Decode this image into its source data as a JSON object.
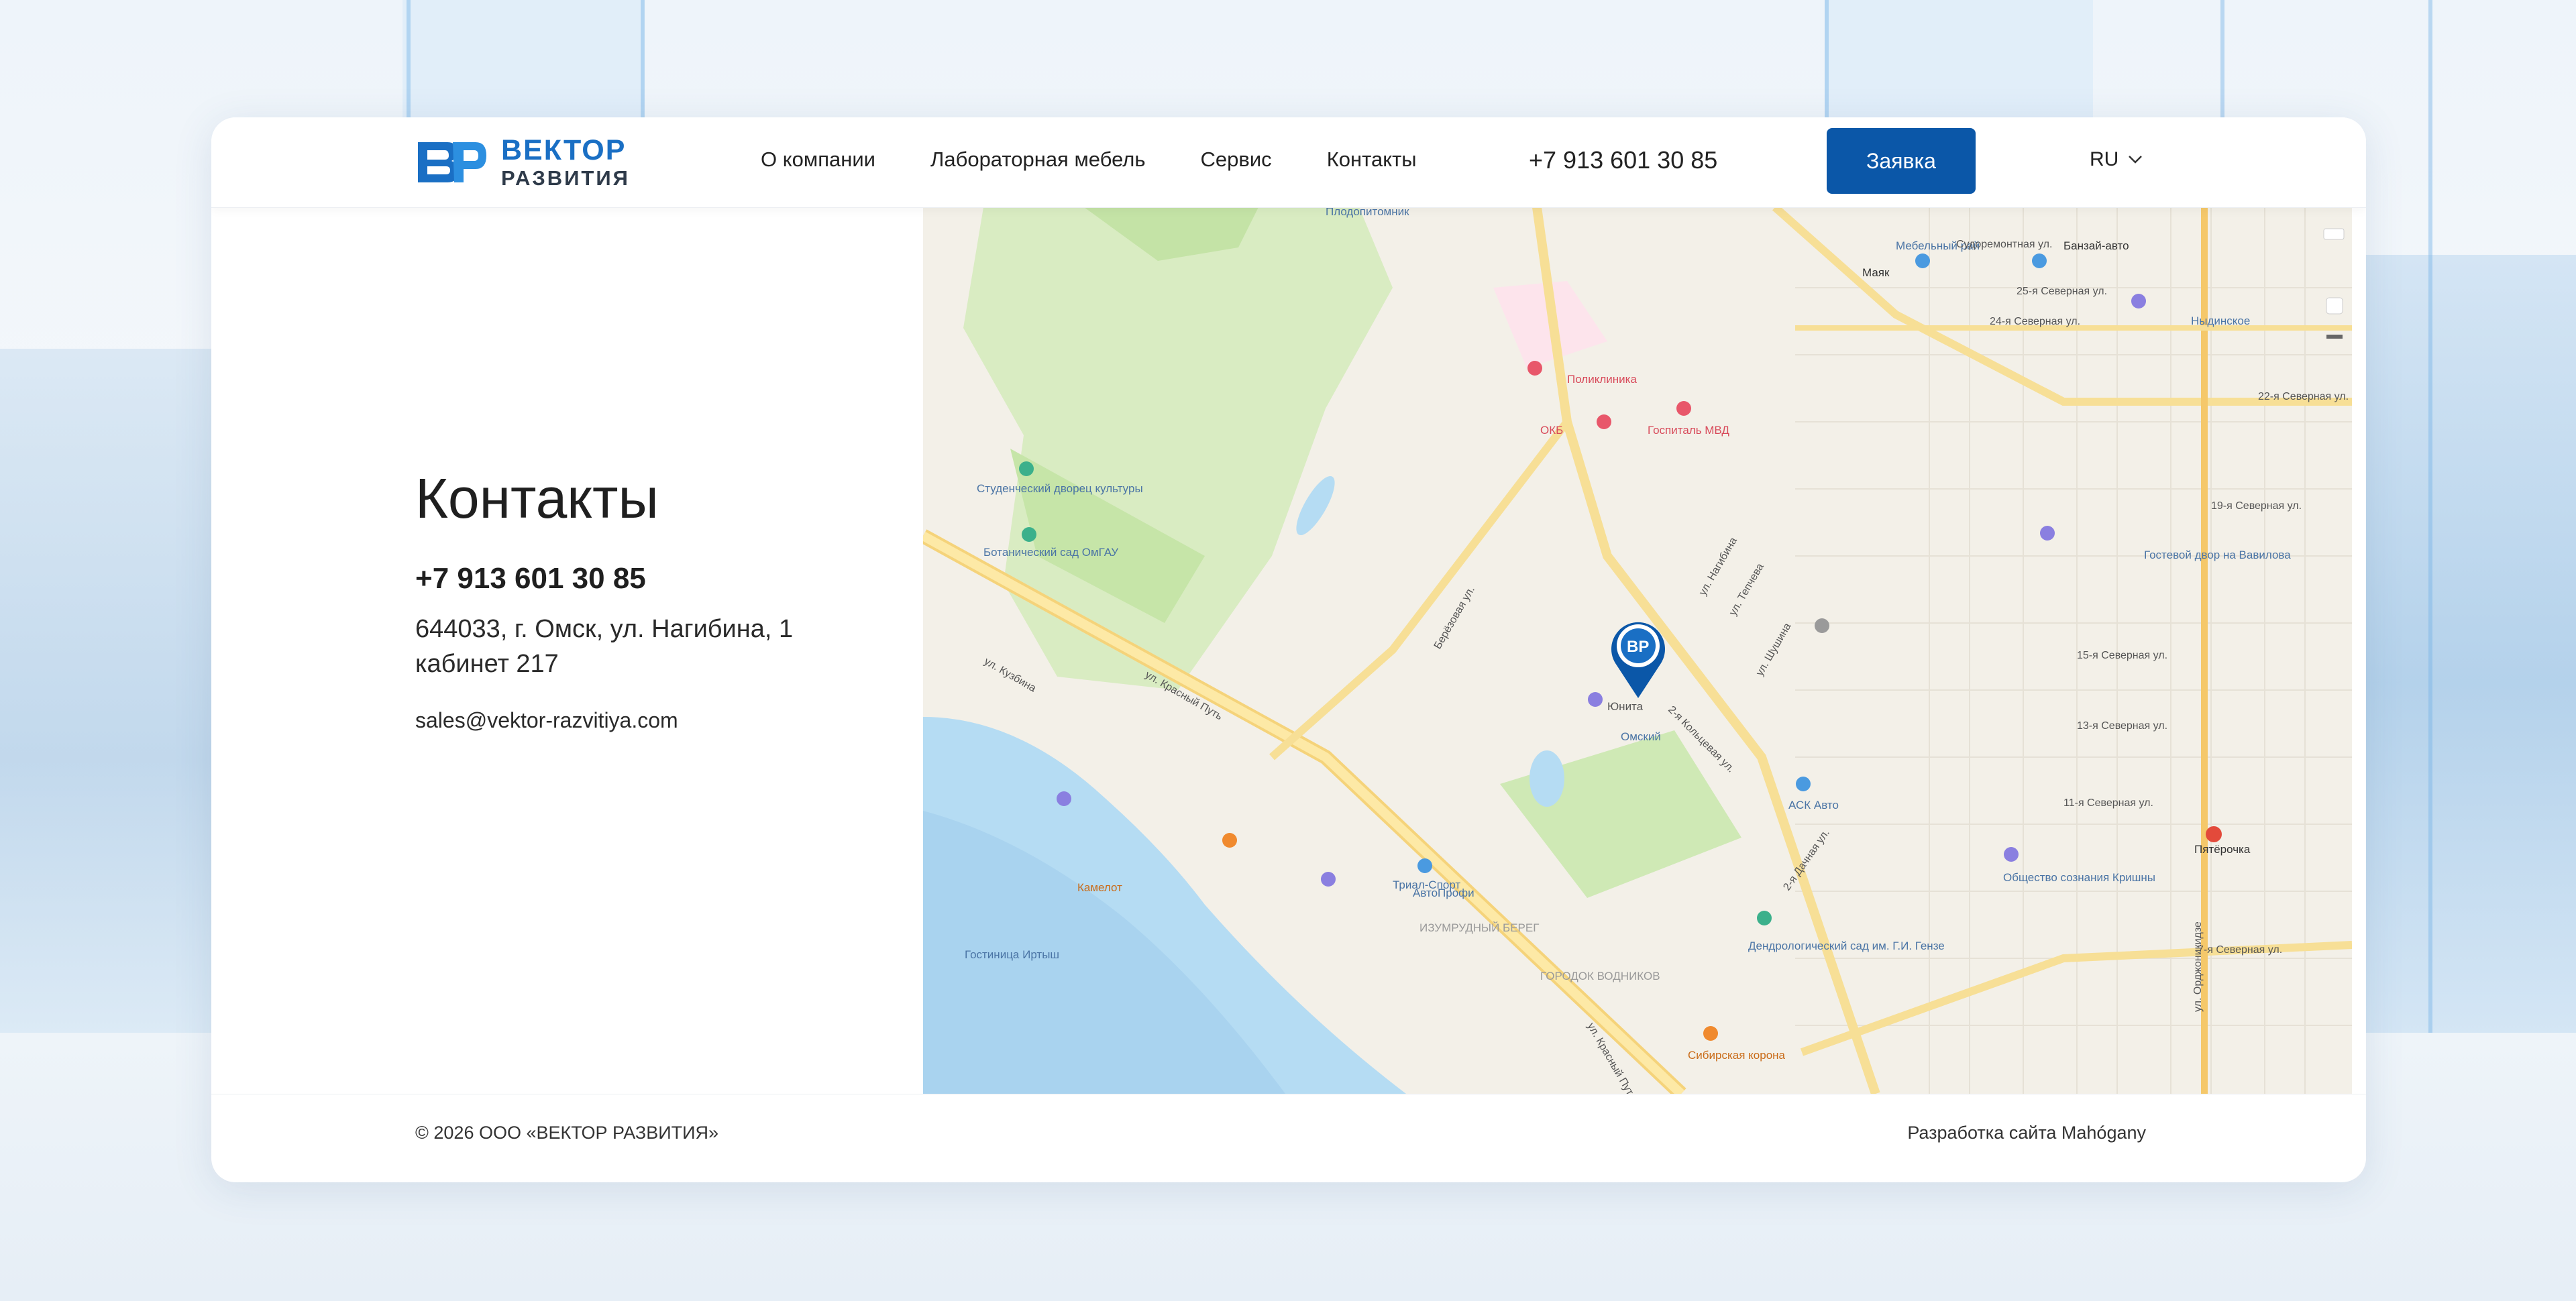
{
  "brand": {
    "name_line1": "ВЕКТОР",
    "name_line2": "РАЗВИТИЯ",
    "color": "#1a6fc4"
  },
  "nav": {
    "items": [
      {
        "label": "О компании"
      },
      {
        "label": "Лабораторная мебель"
      },
      {
        "label": "Сервис"
      },
      {
        "label": "Контакты"
      }
    ],
    "phone": "+7 913 601 30 85",
    "cta": "Заявка",
    "lang": "RU"
  },
  "contacts": {
    "title": "Контакты",
    "phone": "+7 913 601 30 85",
    "address_line1": "644033, г. Омск, ул. Нагибина, 1",
    "address_line2": "кабинет 217",
    "email": "sales@vektor-razvitiya.com"
  },
  "map": {
    "labels": {
      "plodopitomnik": "Плодопитомник",
      "poliklinika": "Поликлиника",
      "okb": "ОКБ",
      "gospital": "Госпиталь МВД",
      "studdvorets": "Студенческий дворец культуры",
      "botsad": "Ботанический сад ОмГАУ",
      "omskiy": "Омский",
      "yunita": "Юнита",
      "askavto": "АСК Авто",
      "gostinica": "Гостиница Иртыш",
      "kamelot": "Камелот",
      "avtoprofi": "АвтоПрофи",
      "trialsport": "Триал-Спорт",
      "dendrosad": "Дендрологический сад им. Г.И. Гензе",
      "izumrud": "ИЗУМРУДНЫЙ БЕРЕГ",
      "gorodok": "ГОРОДОК ВОДНИКОВ",
      "sibkorona": "Сибирская корона",
      "mayak": "Маяк",
      "mebelray": "Мебельный рай",
      "banzay": "Банзай-авто",
      "nydinskoe": "Ныдинское",
      "gostdvor": "Гостевой двор на Вавилова",
      "obshchestvo": "Общество сознания Кришны",
      "pyaterochka": "Пятёрочка",
      "krasny_put": "ул. Красный Путь",
      "krasny_put2": "ул. Красный Путь",
      "berezovaya": "Берёзовая ул.",
      "kuzbina": "ул. Кузбина",
      "koltsevaya": "2-я Кольцевая ул.",
      "nagibina": "ул. Нагибина",
      "tepcheva": "ул. Тепчева",
      "shushina": "ул. Шушина",
      "dachnaya": "2-я Дачная ул.",
      "s7": "7-я Северная ул.",
      "s11": "11-я Северная ул.",
      "s13": "13-я Северная ул.",
      "s15": "15-я Северная ул.",
      "s19": "19-я Северная ул.",
      "s22": "22-я Северная ул.",
      "s24": "24-я Северная ул.",
      "s25": "25-я Северная ул.",
      "ordzhonikidze": "ул. Орджоникидзе",
      "sudoremontnaya": "Судоремонтная ул."
    }
  },
  "footer": {
    "copyright": "© 2026 ООО «ВЕКТОР РАЗВИТИЯ»",
    "developer": "Разработка сайта Mahógany"
  }
}
